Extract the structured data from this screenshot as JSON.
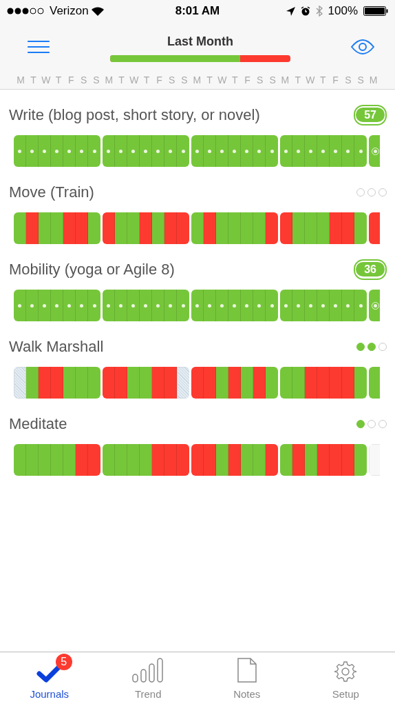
{
  "status_bar": {
    "carrier": "Verizon",
    "time": "8:01 AM",
    "battery": "100%"
  },
  "header": {
    "title": "Last Month",
    "level": 0.72
  },
  "weekdays": [
    "M",
    "T",
    "W",
    "T",
    "F",
    "S",
    "S",
    "M",
    "T",
    "W",
    "T",
    "F",
    "S",
    "S",
    "M",
    "T",
    "W",
    "T",
    "F",
    "S",
    "S",
    "M",
    "T",
    "W",
    "T",
    "F",
    "S",
    "S",
    "M"
  ],
  "habits": [
    {
      "name": "Write (blog post, short story, or novel)",
      "kind": "count",
      "count": "57",
      "days": [
        {
          "done": true,
          "dot": true,
          "today": false
        },
        {
          "done": true,
          "dot": true,
          "today": false
        },
        {
          "done": true,
          "dot": true,
          "today": false
        },
        {
          "done": true,
          "dot": true,
          "today": false
        },
        {
          "done": true,
          "dot": true,
          "today": false
        },
        {
          "done": true,
          "dot": true,
          "today": false
        },
        {
          "done": true,
          "dot": true,
          "today": false
        },
        {
          "done": true,
          "dot": true,
          "today": false
        },
        {
          "done": true,
          "dot": true,
          "today": false
        },
        {
          "done": true,
          "dot": true,
          "today": false
        },
        {
          "done": true,
          "dot": true,
          "today": false
        },
        {
          "done": true,
          "dot": true,
          "today": false
        },
        {
          "done": true,
          "dot": true,
          "today": false
        },
        {
          "done": true,
          "dot": true,
          "today": false
        },
        {
          "done": true,
          "dot": true,
          "today": false
        },
        {
          "done": true,
          "dot": true,
          "today": false
        },
        {
          "done": true,
          "dot": true,
          "today": false
        },
        {
          "done": true,
          "dot": true,
          "today": false
        },
        {
          "done": true,
          "dot": true,
          "today": false
        },
        {
          "done": true,
          "dot": true,
          "today": false
        },
        {
          "done": true,
          "dot": true,
          "today": false
        },
        {
          "done": true,
          "dot": true,
          "today": false
        },
        {
          "done": true,
          "dot": true,
          "today": false
        },
        {
          "done": true,
          "dot": true,
          "today": false
        },
        {
          "done": true,
          "dot": true,
          "today": false
        },
        {
          "done": true,
          "dot": true,
          "today": false
        },
        {
          "done": true,
          "dot": true,
          "today": false
        },
        {
          "done": true,
          "dot": true,
          "today": false
        },
        {
          "done": true,
          "dot": true,
          "today": true
        }
      ]
    },
    {
      "name": "Move (Train)",
      "kind": "dots",
      "dots": [
        {
          "filled": false
        },
        {
          "filled": false
        },
        {
          "filled": false
        }
      ],
      "days": [
        {
          "done": true
        },
        {
          "done": false
        },
        {
          "done": true
        },
        {
          "done": true
        },
        {
          "done": false
        },
        {
          "done": false
        },
        {
          "done": true
        },
        {
          "done": false
        },
        {
          "done": true
        },
        {
          "done": true
        },
        {
          "done": false
        },
        {
          "done": true
        },
        {
          "done": false
        },
        {
          "done": false
        },
        {
          "done": true
        },
        {
          "done": false
        },
        {
          "done": true
        },
        {
          "done": true
        },
        {
          "done": true
        },
        {
          "done": true
        },
        {
          "done": false
        },
        {
          "done": false
        },
        {
          "done": true
        },
        {
          "done": true
        },
        {
          "done": true
        },
        {
          "done": false
        },
        {
          "done": false
        },
        {
          "done": true
        },
        {
          "done": false
        }
      ]
    },
    {
      "name": "Mobility (yoga or Agile 8)",
      "kind": "count",
      "count": "36",
      "days": [
        {
          "done": true,
          "dot": true,
          "today": false
        },
        {
          "done": true,
          "dot": true,
          "today": false
        },
        {
          "done": true,
          "dot": true,
          "today": false
        },
        {
          "done": true,
          "dot": true,
          "today": false
        },
        {
          "done": true,
          "dot": true,
          "today": false
        },
        {
          "done": true,
          "dot": true,
          "today": false
        },
        {
          "done": true,
          "dot": true,
          "today": false
        },
        {
          "done": true,
          "dot": true,
          "today": false
        },
        {
          "done": true,
          "dot": true,
          "today": false
        },
        {
          "done": true,
          "dot": true,
          "today": false
        },
        {
          "done": true,
          "dot": true,
          "today": false
        },
        {
          "done": true,
          "dot": true,
          "today": false
        },
        {
          "done": true,
          "dot": true,
          "today": false
        },
        {
          "done": true,
          "dot": true,
          "today": false
        },
        {
          "done": true,
          "dot": true,
          "today": false
        },
        {
          "done": true,
          "dot": true,
          "today": false
        },
        {
          "done": true,
          "dot": true,
          "today": false
        },
        {
          "done": true,
          "dot": true,
          "today": false
        },
        {
          "done": true,
          "dot": true,
          "today": false
        },
        {
          "done": true,
          "dot": true,
          "today": false
        },
        {
          "done": true,
          "dot": true,
          "today": false
        },
        {
          "done": true,
          "dot": true,
          "today": false
        },
        {
          "done": true,
          "dot": true,
          "today": false
        },
        {
          "done": true,
          "dot": true,
          "today": false
        },
        {
          "done": true,
          "dot": true,
          "today": false
        },
        {
          "done": true,
          "dot": true,
          "today": false
        },
        {
          "done": true,
          "dot": true,
          "today": false
        },
        {
          "done": true,
          "dot": true,
          "today": false
        },
        {
          "done": true,
          "dot": true,
          "today": true
        }
      ]
    },
    {
      "name": "Walk Marshall",
      "kind": "dots",
      "dots": [
        {
          "filled": true
        },
        {
          "filled": true
        },
        {
          "filled": false
        }
      ],
      "days": [
        {
          "done": false,
          "skipped": true
        },
        {
          "done": true,
          "skipped": false
        },
        {
          "done": false,
          "skipped": false
        },
        {
          "done": false,
          "skipped": false
        },
        {
          "done": true,
          "skipped": false
        },
        {
          "done": true,
          "skipped": false
        },
        {
          "done": true,
          "skipped": false
        },
        {
          "done": false,
          "skipped": false
        },
        {
          "done": false,
          "skipped": false
        },
        {
          "done": true,
          "skipped": false
        },
        {
          "done": true,
          "skipped": false
        },
        {
          "done": false,
          "skipped": false
        },
        {
          "done": false,
          "skipped": false
        },
        {
          "done": false,
          "skipped": true
        },
        {
          "done": false,
          "skipped": false
        },
        {
          "done": false,
          "skipped": false
        },
        {
          "done": true,
          "skipped": false
        },
        {
          "done": false,
          "skipped": false
        },
        {
          "done": true,
          "skipped": false
        },
        {
          "done": false,
          "skipped": false
        },
        {
          "done": true,
          "skipped": false
        },
        {
          "done": true,
          "skipped": false
        },
        {
          "done": true,
          "skipped": false
        },
        {
          "done": false,
          "skipped": false
        },
        {
          "done": false,
          "skipped": false
        },
        {
          "done": false,
          "skipped": false
        },
        {
          "done": false,
          "skipped": false
        },
        {
          "done": true,
          "skipped": false
        },
        {
          "done": true,
          "skipped": false
        }
      ]
    },
    {
      "name": "Meditate",
      "kind": "dots",
      "dots": [
        {
          "filled": true
        },
        {
          "filled": false
        },
        {
          "filled": false
        }
      ],
      "days": [
        {
          "done": true,
          "blank": false
        },
        {
          "done": true,
          "blank": false
        },
        {
          "done": true,
          "blank": false
        },
        {
          "done": true,
          "blank": false
        },
        {
          "done": true,
          "blank": false
        },
        {
          "done": false,
          "blank": false
        },
        {
          "done": false,
          "blank": false
        },
        {
          "done": true,
          "blank": false
        },
        {
          "done": true,
          "blank": false
        },
        {
          "done": true,
          "blank": false
        },
        {
          "done": true,
          "blank": false
        },
        {
          "done": false,
          "blank": false
        },
        {
          "done": false,
          "blank": false
        },
        {
          "done": false,
          "blank": false
        },
        {
          "done": false,
          "blank": false
        },
        {
          "done": false,
          "blank": false
        },
        {
          "done": true,
          "blank": false
        },
        {
          "done": false,
          "blank": false
        },
        {
          "done": true,
          "blank": false
        },
        {
          "done": true,
          "blank": false
        },
        {
          "done": false,
          "blank": false
        },
        {
          "done": true,
          "blank": false
        },
        {
          "done": false,
          "blank": false
        },
        {
          "done": true,
          "blank": false
        },
        {
          "done": false,
          "blank": false
        },
        {
          "done": false,
          "blank": false
        },
        {
          "done": false,
          "blank": false
        },
        {
          "done": true,
          "blank": false
        },
        {
          "done": false,
          "blank": true
        }
      ]
    }
  ],
  "tabs": [
    {
      "label": "Journals",
      "kind": "journals",
      "selected": true,
      "badge": "5"
    },
    {
      "label": "Trend",
      "kind": "trend",
      "selected": false
    },
    {
      "label": "Notes",
      "kind": "notes",
      "selected": false
    },
    {
      "label": "Setup",
      "kind": "setup",
      "selected": false
    }
  ]
}
